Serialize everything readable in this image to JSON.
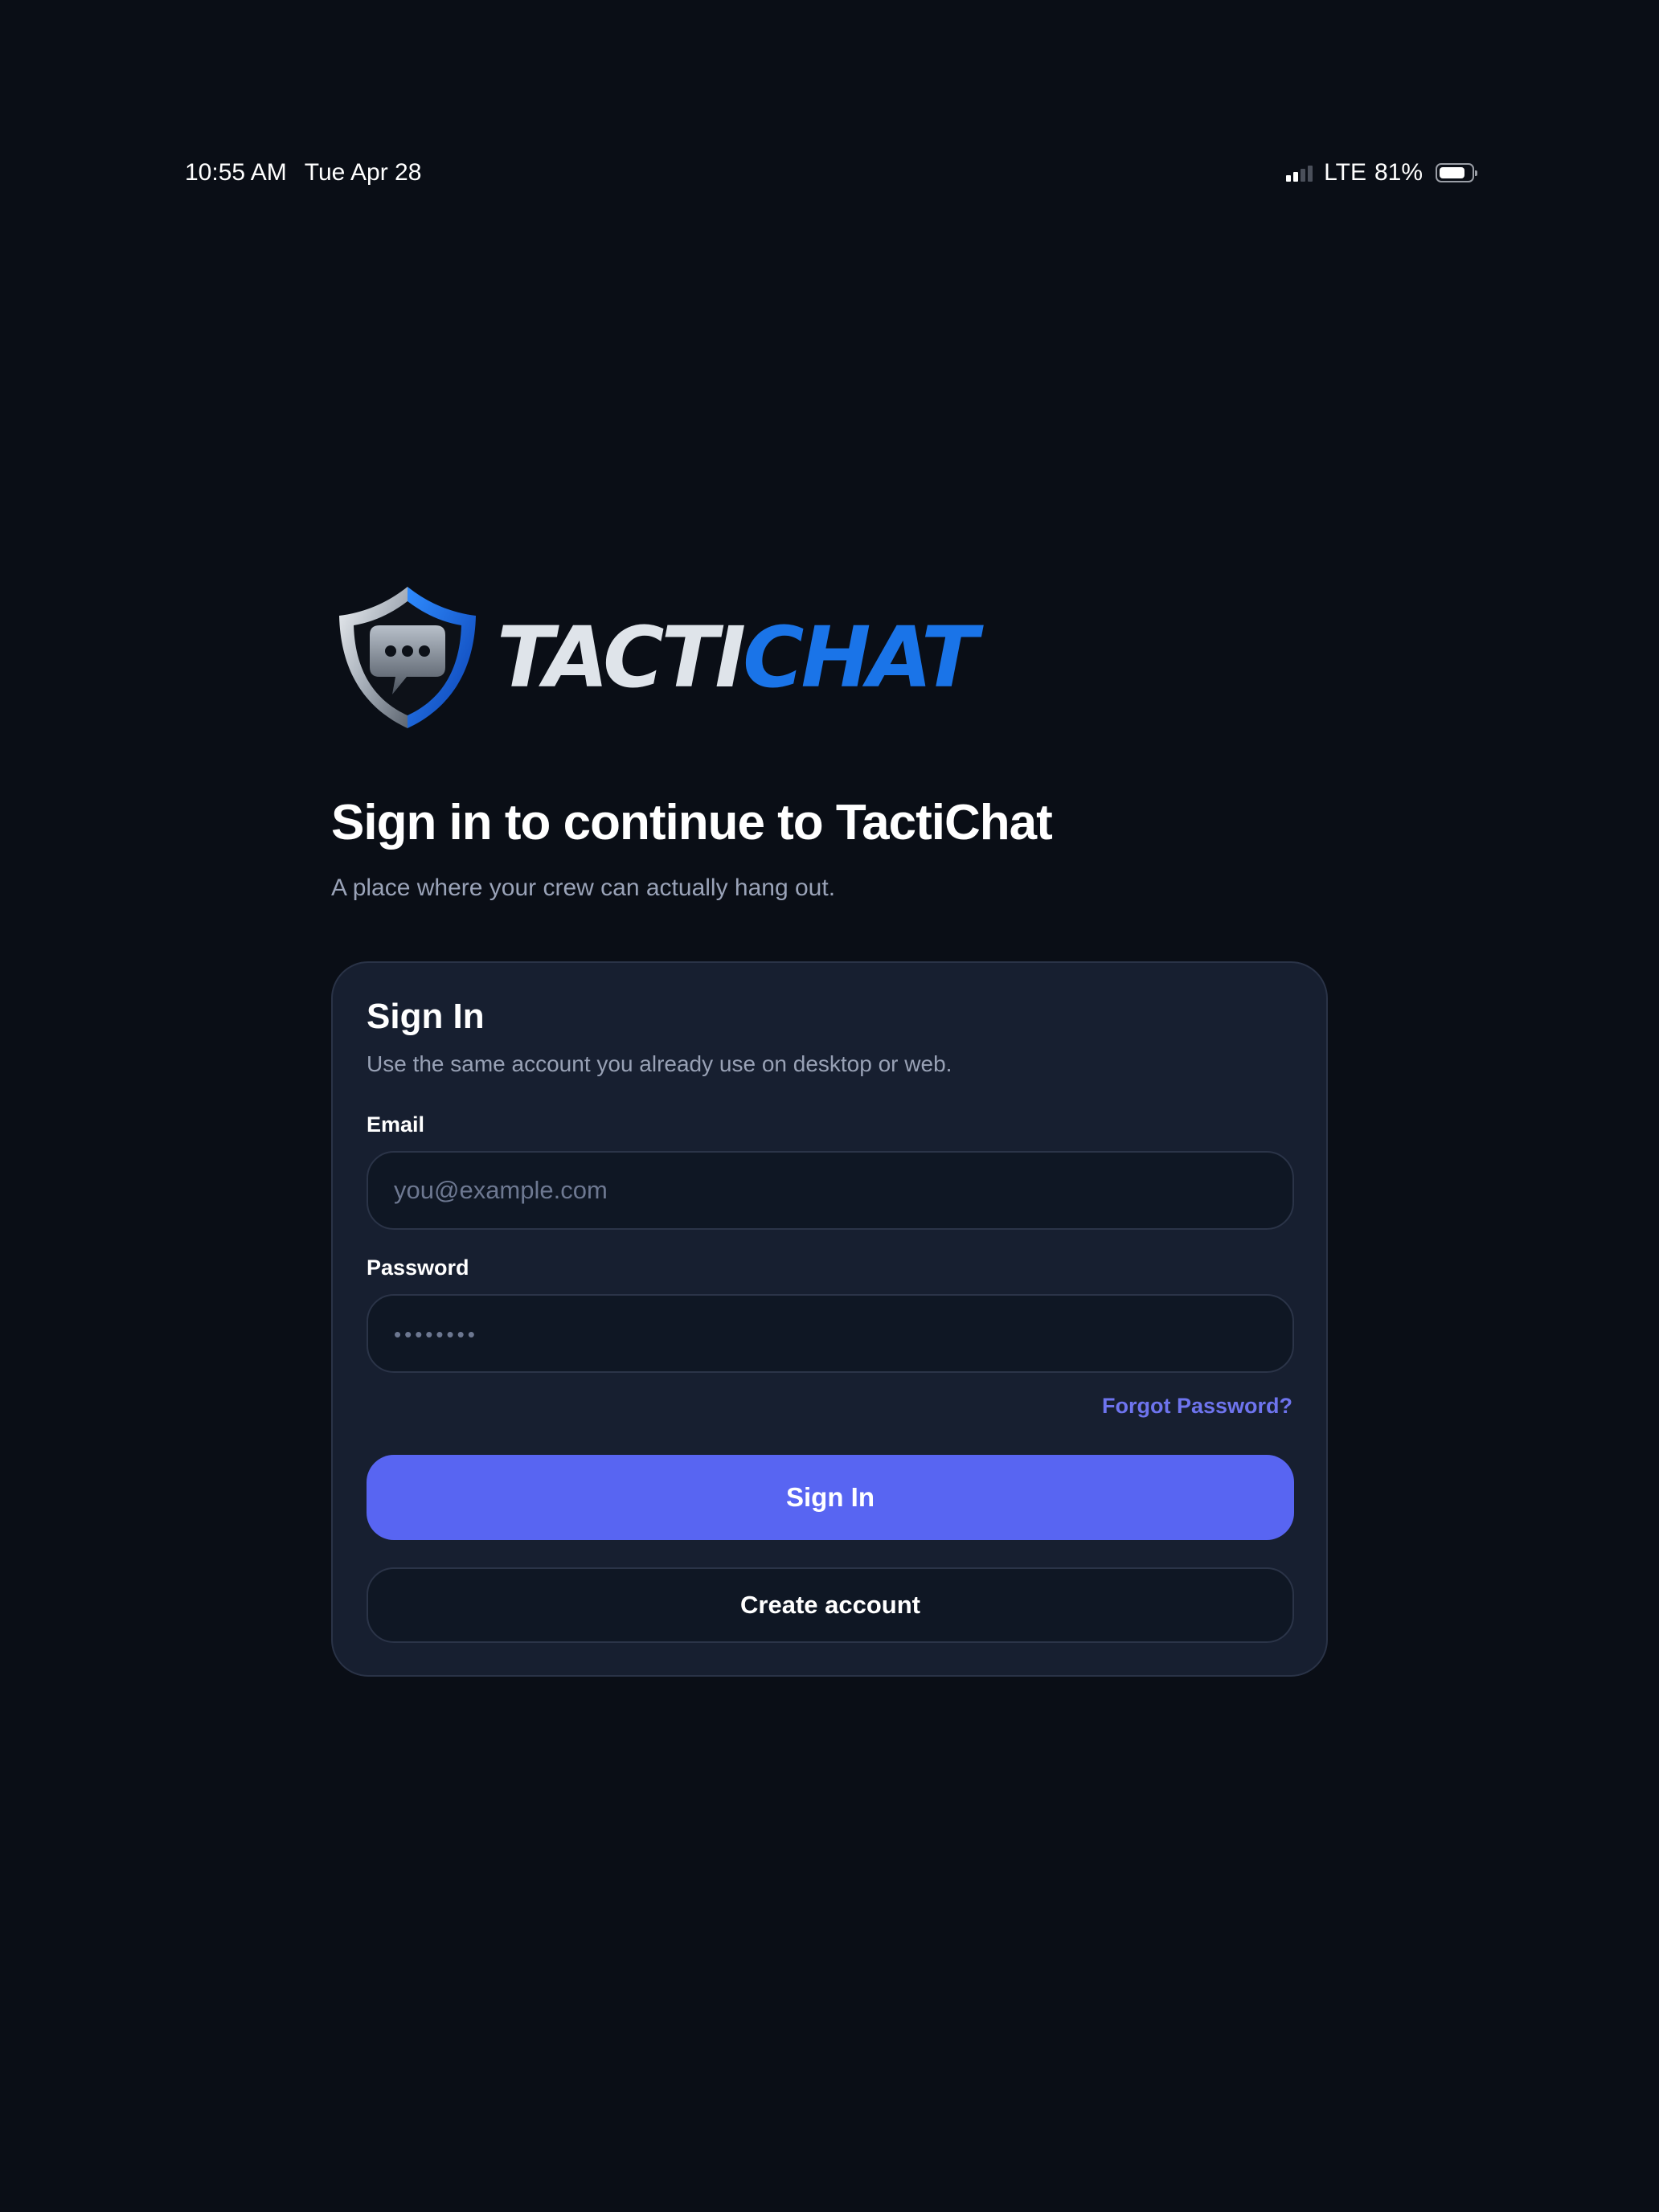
{
  "status_bar": {
    "time": "10:55 AM",
    "date": "Tue Apr 28",
    "network": "LTE",
    "battery": "81%",
    "battery_level": 0.81,
    "signal_bars": 2,
    "signal_bars_total": 4
  },
  "logo": {
    "text_part1": "TACTI",
    "text_part2": "CHAT",
    "colors": {
      "silver": "#dfe4ea",
      "blue": "#1a74e8"
    }
  },
  "header": {
    "title": "Sign in to continue to TactiChat",
    "subtitle": "A place where your crew can actually hang out."
  },
  "card": {
    "title": "Sign In",
    "subtitle": "Use the same account you already use on desktop or web.",
    "email_label": "Email",
    "email_placeholder": "you@example.com",
    "email_value": "",
    "password_label": "Password",
    "password_placeholder": "••••••••",
    "password_value": "",
    "forgot_label": "Forgot Password?",
    "sign_in_label": "Sign In",
    "create_account_label": "Create account"
  },
  "colors": {
    "background": "#0a0e16",
    "card": "#171f30",
    "accent": "#5865f2",
    "link": "#6e74ee"
  }
}
